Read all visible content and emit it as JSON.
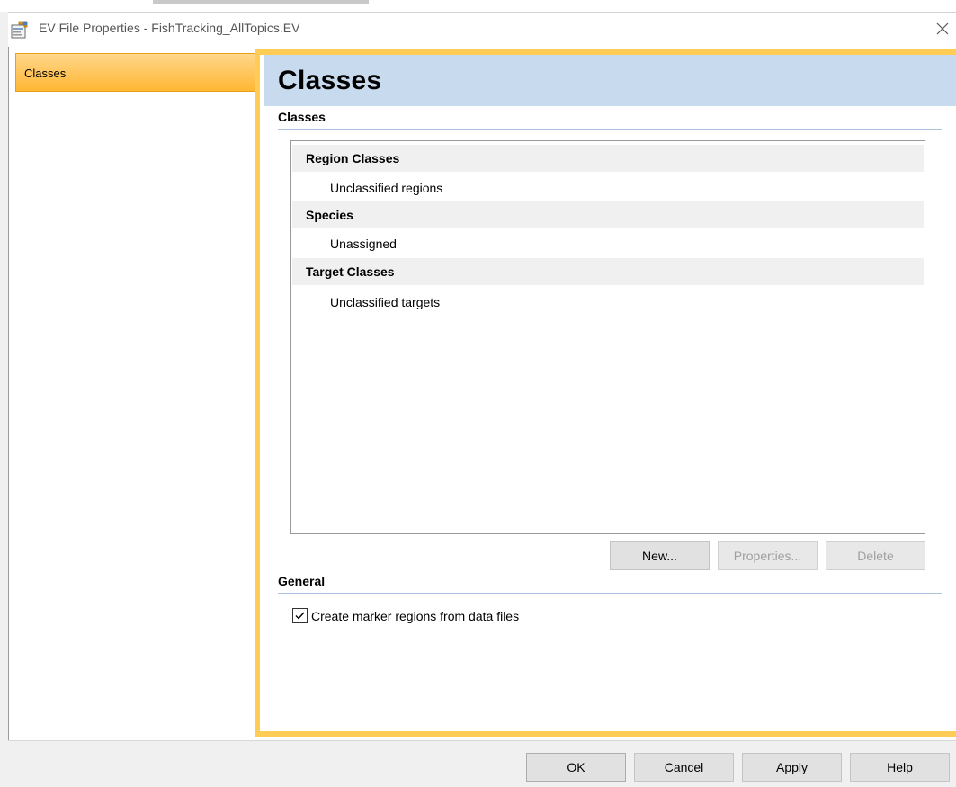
{
  "window": {
    "title": "EV File Properties - FishTracking_AllTopics.EV",
    "icon": "properties-app-icon",
    "close_icon": "close-icon"
  },
  "nav": {
    "items": [
      {
        "label": "Classes",
        "selected": true
      }
    ]
  },
  "page": {
    "title": "Classes",
    "classes_section": {
      "heading": "Classes",
      "groups": [
        {
          "header": "Region Classes",
          "items": [
            "Unclassified regions"
          ]
        },
        {
          "header": "Species",
          "items": [
            "Unassigned"
          ]
        },
        {
          "header": "Target Classes",
          "items": [
            "Unclassified targets"
          ]
        }
      ],
      "buttons": {
        "new_label": "New...",
        "properties_label": "Properties...",
        "delete_label": "Delete"
      }
    },
    "general_section": {
      "heading": "General",
      "checkbox_label": "Create marker regions from data files",
      "checkbox_checked": true
    }
  },
  "footer": {
    "ok_label": "OK",
    "cancel_label": "Cancel",
    "apply_label": "Apply",
    "help_label": "Help"
  },
  "colors": {
    "accent_orange": "#ffcd55",
    "header_blue": "#c8daee",
    "nav_selected": "#ffb733"
  }
}
